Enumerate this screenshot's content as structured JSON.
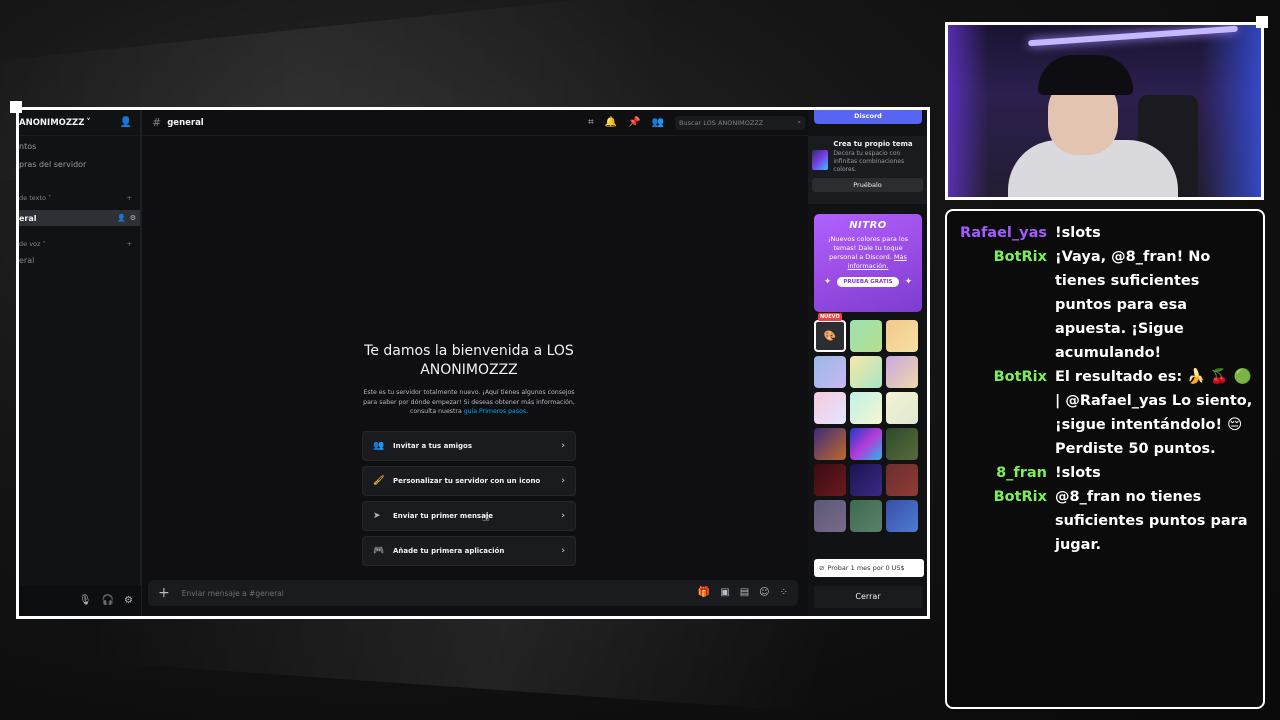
{
  "discord": {
    "server_name": "ANONIMOZZZ",
    "sidebar_items": [
      "ntos",
      "pras del servidor"
    ],
    "text_category": "de texto",
    "active_channel": "eral",
    "voice_category": "de voz",
    "voice_channel": "eral",
    "channel_title": "general",
    "search_placeholder": "Buscar LOS ANONIMOZZZ",
    "welcome_title": "Te damos la bienvenida a LOS ANONIMOZZZ",
    "welcome_text": "Este es tu servidor totalmente nuevo. ¡Aquí tienes algunos consejos para saber por dónde empezar! Si deseas obtener más información, consulta nuestra",
    "welcome_link": "guía Primeros pasos",
    "welcome_end": ".",
    "actions": [
      {
        "label": "Invitar a tus amigos",
        "icon": "people-icon"
      },
      {
        "label": "Personalizar tu servidor con un icono",
        "icon": "paint-icon"
      },
      {
        "label": "Enviar tu primer mensaje",
        "icon": "send-icon"
      },
      {
        "label": "Añade tu primera aplicación",
        "icon": "gamepad-icon"
      }
    ],
    "composer_placeholder": "Enviar mensaje a #general",
    "panel": {
      "discord_tab": "Discord",
      "theme_title": "Crea tu propio tema",
      "theme_desc": "Decora tu espacio con infinitas combinaciones colores.",
      "theme_try": "Pruébalo",
      "nitro_logo": "NITRO",
      "nitro_msg": "¡Nuevos colores para los temas! Dale tu toque personal a Discord.",
      "nitro_more": "Más información.",
      "nitro_cta": "PRUEBA GRATIS",
      "new_badge": "NUEVO",
      "try_month": "Probar 1 mes por 0 US$",
      "close": "Cerrar"
    }
  },
  "chat": {
    "messages": [
      {
        "user": "Rafael_yas",
        "text": "!slots",
        "color": "#a25cff"
      },
      {
        "user": "BotRix",
        "text": "¡Vaya, @8_fran! No tienes suficientes puntos para esa apuesta. ¡Sigue acumulando!",
        "color": "#7cf05a"
      },
      {
        "user": "BotRix",
        "text": "El resultado es: 🍌 🍒 🟢 | @Rafael_yas Lo siento, ¡sigue intentándolo! 😔 Perdiste 50 puntos.",
        "color": "#7cf05a"
      },
      {
        "user": "8_fran",
        "text": "!slots",
        "color": "#7cf05a"
      },
      {
        "user": "BotRix",
        "text": "@8_fran no tienes suficientes puntos para jugar.",
        "color": "#7cf05a"
      }
    ]
  }
}
